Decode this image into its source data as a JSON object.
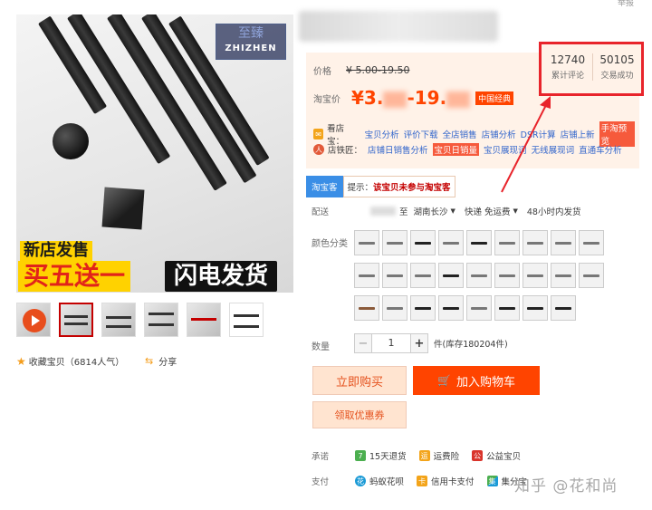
{
  "corner_text": "举报",
  "gallery": {
    "brand_cn": "至臻",
    "brand_en": "ZHIZHEN",
    "promo_new": "新店发售",
    "promo_big": "买五送一",
    "promo_fast": "闪电发货",
    "favorite": "收藏宝贝（6814人气）",
    "share": "分享"
  },
  "price": {
    "orig_label": "价格",
    "orig_value": "¥ 5.00-19.50",
    "tb_label": "淘宝价",
    "tb_prefix": "¥3.",
    "tb_suffix": "-19.",
    "tb_badge": "中国经典"
  },
  "services": {
    "row1_label": "看店宝：",
    "row1_links": [
      "宝贝分析",
      "评价下载",
      "全店销售",
      "店铺分析",
      "DSR计算",
      "店铺上新"
    ],
    "row1_highlight": "手淘预览",
    "row2_label": "店铁匠：",
    "row2_links": [
      "店铺日销售分析"
    ],
    "row2_highlight": "宝贝日销量",
    "row2_links_b": [
      "宝贝展现词",
      "无线展现词",
      "直通车分析"
    ]
  },
  "stats": {
    "reviews_count": "12740",
    "reviews_label": "累计评论",
    "trades_count": "50105",
    "trades_label": "交易成功"
  },
  "coupon": {
    "tag": "淘宝客",
    "hint": "提示：",
    "hint_red": "该宝贝未参与淘宝客"
  },
  "shipping": {
    "label": "配送",
    "to": "至",
    "dest": "湖南长沙",
    "method": "快递 免运费",
    "time": "48小时内发货"
  },
  "sku": {
    "label": "颜色分类"
  },
  "quantity": {
    "label": "数量",
    "value": "1",
    "minus": "−",
    "plus": "+",
    "stock": "件(库存180204件)"
  },
  "actions": {
    "buy": "立即购买",
    "cart": "加入购物车",
    "coupon": "领取优惠券"
  },
  "promise": {
    "label": "承诺",
    "items": [
      "15天退货",
      "运费险",
      "公益宝贝"
    ],
    "icon_texts": [
      "7",
      "运",
      "公"
    ]
  },
  "payment": {
    "label": "支付",
    "items": [
      "蚂蚁花呗",
      "信用卡支付",
      "集分宝"
    ],
    "icon_texts": [
      "花",
      "卡",
      "集"
    ]
  },
  "watermark": "知乎 @花和尚"
}
